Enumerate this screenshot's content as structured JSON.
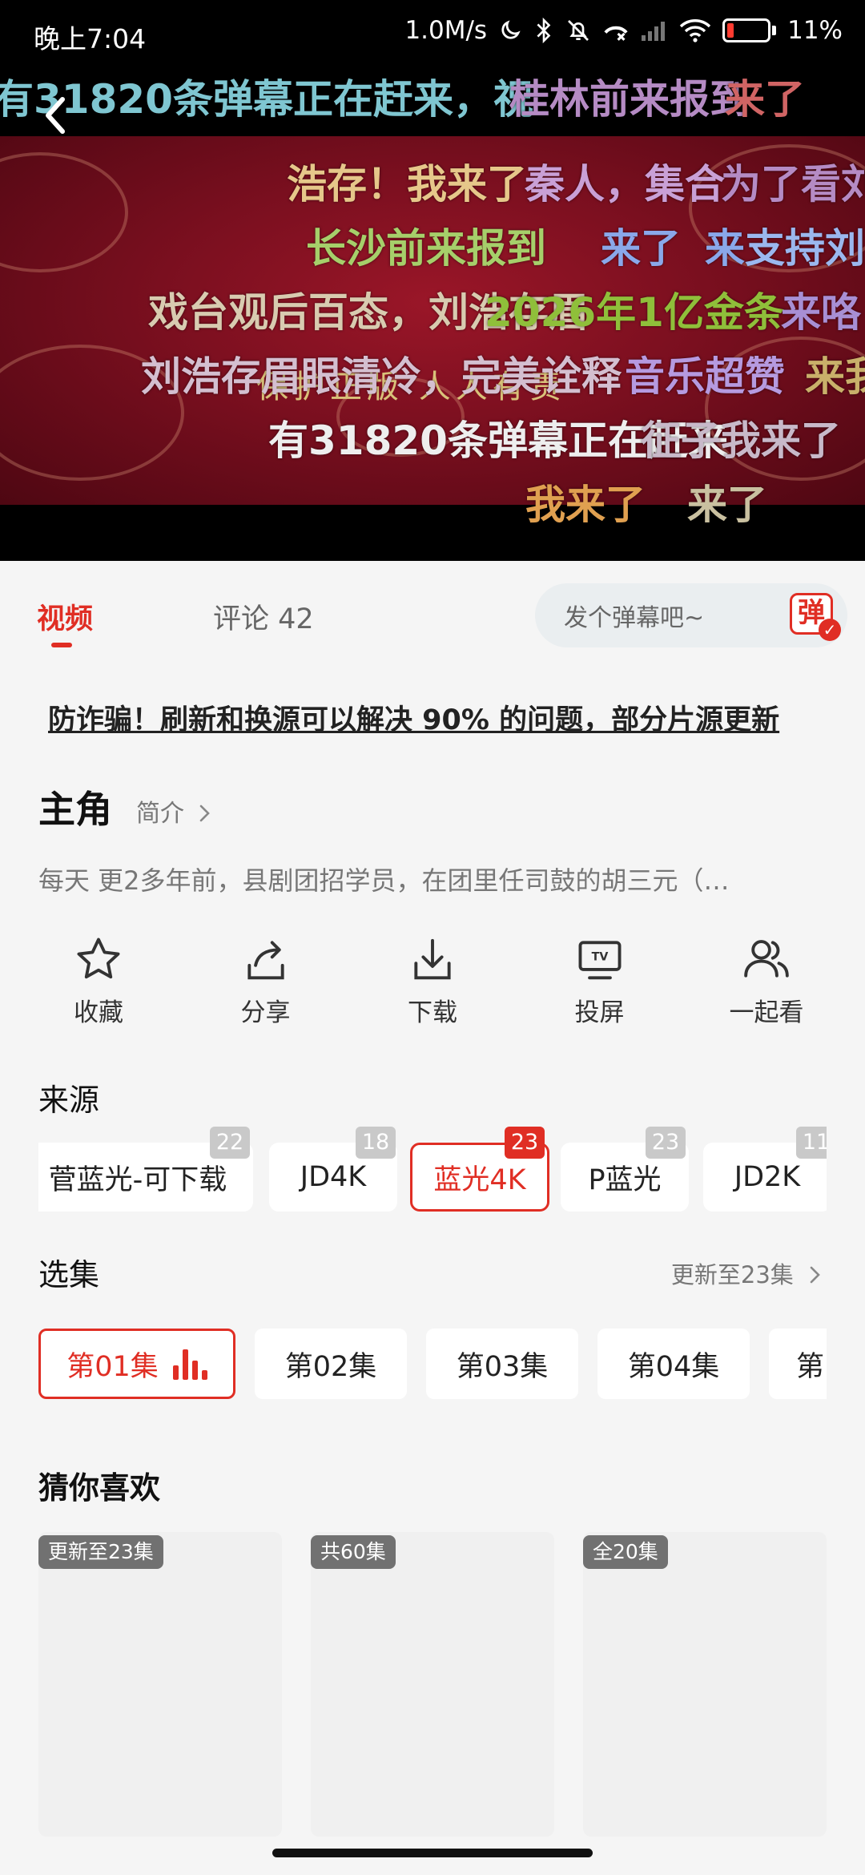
{
  "status_bar": {
    "time": "晚上7:04",
    "net_speed": "1.0M/s",
    "battery": "11%",
    "icons": [
      "moon-icon",
      "bluetooth-icon",
      "mute-bell-icon",
      "missed-call-icon",
      "signal-icon",
      "wifi-icon",
      "battery-icon"
    ]
  },
  "video": {
    "title_text": "保护正版 人人有责",
    "danmaku": [
      "有31820条弹幕正在赶来，祝",
      "桂林前来报到",
      "来了",
      "浩存！我来了",
      "秦人，集合",
      "为了看刘",
      "长沙前来报到",
      "来了",
      "来",
      "支持刘",
      "戏台观后百态，刘浩存眉",
      "2026年1亿金条",
      "来咯",
      "刘浩存眉眼清冷，完美诠释",
      "音乐超赞",
      "来我",
      "有31820条弹幕正在赶来",
      "征子我来了",
      "我来了",
      "来了"
    ]
  },
  "tabs": {
    "video": "视频",
    "comments": "评论 42",
    "danmaku_placeholder": "发个弹幕吧~",
    "danmaku_toggle": "弹"
  },
  "notice": "防诈骗！刷新和换源可以解决 90% 的问题，部分片源更新",
  "show": {
    "title": "主角",
    "intro_link": "简介",
    "synopsis": "每天 更2多年前，县剧团招学员，在团里任司鼓的胡三元（…"
  },
  "actions": [
    {
      "label": "收藏",
      "icon": "star-icon"
    },
    {
      "label": "分享",
      "icon": "share-icon"
    },
    {
      "label": "下载",
      "icon": "download-icon"
    },
    {
      "label": "投屏",
      "icon": "tv-cast-icon"
    },
    {
      "label": "一起看",
      "icon": "watch-together-icon"
    }
  ],
  "sources": {
    "heading": "来源",
    "items": [
      {
        "label": "菅蓝光-可下载",
        "count": "22",
        "active": false
      },
      {
        "label": "JD4K",
        "count": "18",
        "active": false
      },
      {
        "label": "蓝光4K",
        "count": "23",
        "active": true
      },
      {
        "label": "P蓝光",
        "count": "23",
        "active": false
      },
      {
        "label": "JD2K",
        "count": "11",
        "active": false
      }
    ]
  },
  "episodes": {
    "heading": "选集",
    "update_text": "更新至23集",
    "items": [
      {
        "label": "第01集",
        "active": true
      },
      {
        "label": "第02集",
        "active": false
      },
      {
        "label": "第03集",
        "active": false
      },
      {
        "label": "第04集",
        "active": false
      },
      {
        "label": "第",
        "active": false
      }
    ]
  },
  "recommendations": {
    "heading": "猜你喜欢",
    "items": [
      {
        "badge": "更新至23集"
      },
      {
        "badge": "共60集"
      },
      {
        "badge": "全20集"
      }
    ]
  },
  "colors": {
    "accent": "#e02e24",
    "background": "#f5f5f5"
  }
}
